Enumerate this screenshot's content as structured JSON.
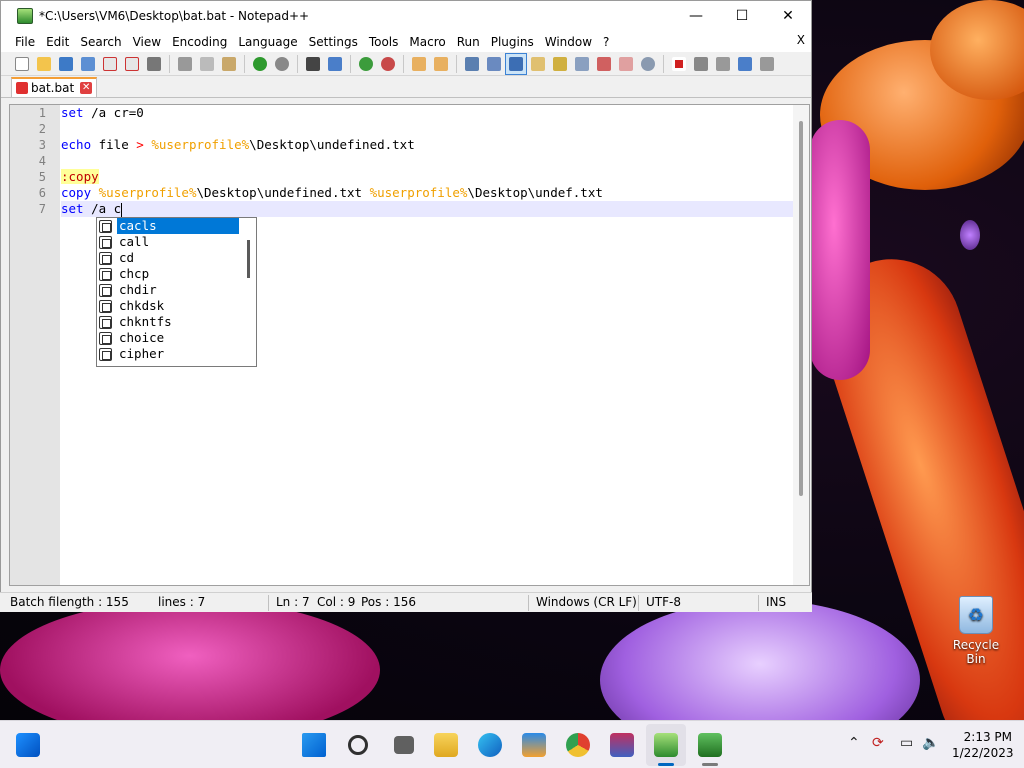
{
  "window": {
    "title": "*C:\\Users\\VM6\\Desktop\\bat.bat - Notepad++",
    "minimize_label": "—",
    "maximize_label": "☐",
    "close_label": "✕"
  },
  "menu": {
    "items": [
      "File",
      "Edit",
      "Search",
      "View",
      "Encoding",
      "Language",
      "Settings",
      "Tools",
      "Macro",
      "Run",
      "Plugins",
      "Window",
      "?"
    ],
    "close_label": "X"
  },
  "tab": {
    "name": "bat.bat",
    "close_label": "✕"
  },
  "editor": {
    "lines": [
      {
        "num": "1",
        "segments": [
          {
            "t": "set",
            "c": "kw"
          },
          {
            "t": " /a cr=0",
            "c": "plain"
          }
        ]
      },
      {
        "num": "2",
        "segments": []
      },
      {
        "num": "3",
        "segments": [
          {
            "t": "echo",
            "c": "kw"
          },
          {
            "t": " file ",
            "c": "plain"
          },
          {
            "t": ">",
            "c": "op"
          },
          {
            "t": " ",
            "c": "plain"
          },
          {
            "t": "%userprofile%",
            "c": "var"
          },
          {
            "t": "\\Desktop\\undefined.txt",
            "c": "plain"
          }
        ]
      },
      {
        "num": "4",
        "segments": []
      },
      {
        "num": "5",
        "segments": [
          {
            "t": ":copy",
            "c": "label"
          }
        ]
      },
      {
        "num": "6",
        "segments": [
          {
            "t": "copy",
            "c": "kw"
          },
          {
            "t": " ",
            "c": "plain"
          },
          {
            "t": "%userprofile%",
            "c": "var"
          },
          {
            "t": "\\Desktop\\undefined.txt ",
            "c": "plain"
          },
          {
            "t": "%userprofile%",
            "c": "var"
          },
          {
            "t": "\\Desktop\\undef.txt",
            "c": "plain"
          }
        ]
      },
      {
        "num": "7",
        "segments": [
          {
            "t": "set",
            "c": "kw"
          },
          {
            "t": " /a c",
            "c": "plain"
          }
        ],
        "current": true
      }
    ]
  },
  "autocomplete": {
    "items": [
      "cacls",
      "call",
      "cd",
      "chcp",
      "chdir",
      "chkdsk",
      "chkntfs",
      "choice",
      "cipher"
    ],
    "selected_index": 0
  },
  "statusbar": {
    "filetype": "Batch fi",
    "length": "length : 155",
    "lines": "lines : 7",
    "ln": "Ln : 7",
    "col": "Col : 9",
    "pos": "Pos : 156",
    "eol": "Windows (CR LF)",
    "encoding": "UTF-8",
    "mode": "INS"
  },
  "desktop": {
    "recycle_bin_label": "Recycle Bin"
  },
  "taskbar": {
    "time": "2:13 PM",
    "date": "1/22/2023"
  },
  "colors": {
    "accent": "#0078d7",
    "keyword": "#0000ff",
    "variable": "#f0a000",
    "operator": "#ff0000"
  }
}
